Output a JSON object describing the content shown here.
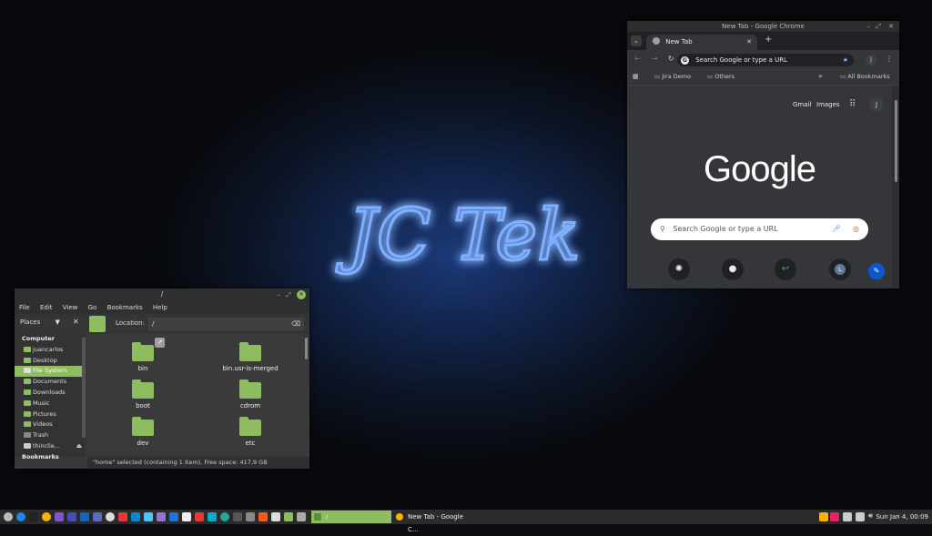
{
  "wallpaper": {
    "neon_text": "JC Tek",
    "neon_color": "#3d7bff"
  },
  "chrome": {
    "window_title": "New Tab - Google Chrome",
    "tab_title": "New Tab",
    "omnibox_placeholder": "Search Google or type a URL",
    "profile_initial": "J",
    "bookmarks": [
      "Jira Demo",
      "Others"
    ],
    "more_bookmarks": "»",
    "all_bookmarks": "All Bookmarks",
    "gmail": "Gmail",
    "images": "Images",
    "logo": "Google",
    "search_placeholder": "Search Google or type a URL",
    "shortcuts": [
      "openai-icon",
      "github-icon",
      "green-arrow-icon",
      "L"
    ],
    "shortcut_l": "L"
  },
  "file_manager": {
    "window_title": "/",
    "menu": [
      "File",
      "Edit",
      "View",
      "Go",
      "Bookmarks",
      "Help"
    ],
    "places_label": "Places",
    "location_label": "Location:",
    "location_value": "/",
    "sidebar": {
      "computer_heading": "Computer",
      "items": [
        "juancarlos",
        "Desktop",
        "File System",
        "Documents",
        "Downloads",
        "Music",
        "Pictures",
        "Videos",
        "Trash",
        "thinclie..."
      ],
      "bookmarks_heading": "Bookmarks"
    },
    "files": [
      "bin",
      "bin.usr-is-merged",
      "boot",
      "cdrom",
      "dev",
      "etc"
    ],
    "status": "\"home\" selected (containing 1 item), Free space: 417,9 GB"
  },
  "taskbar": {
    "windows": [
      "/",
      "New Tab - Google C..."
    ],
    "clock": "Sun Jan  4, 00:09"
  }
}
